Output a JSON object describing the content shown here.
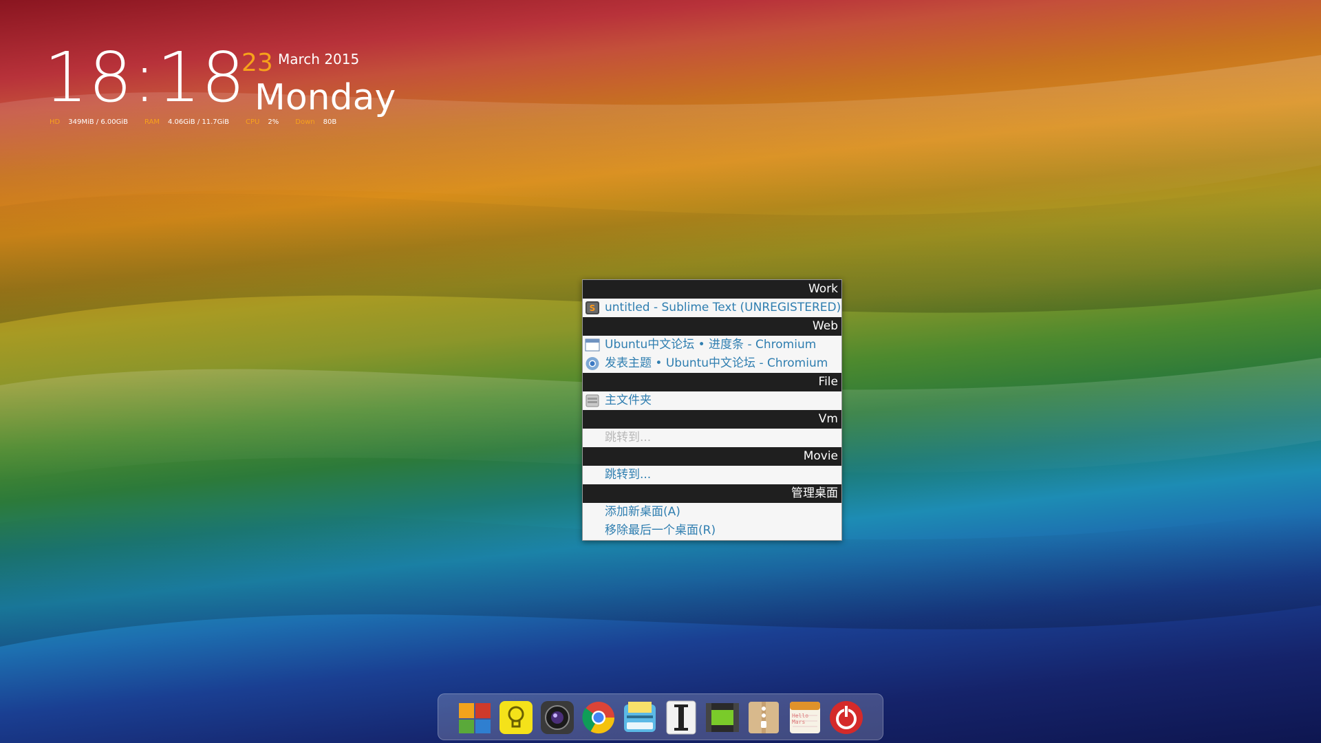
{
  "clock": {
    "time": "18:18",
    "day_number": "23",
    "month_year": "March 2015",
    "weekday": "Monday"
  },
  "stats": {
    "hd_label": "HD",
    "hd_value": "349MiB  / 6.00GiB",
    "ram_label": "RAM",
    "ram_value": "4.06GiB / 11.7GiB",
    "cpu_label": "CPU",
    "cpu_value": "2%",
    "down_label": "Down",
    "down_value": "80B"
  },
  "menu": {
    "sections": [
      {
        "header": "Work",
        "items": [
          {
            "label": "untitled - Sublime Text (UNREGISTERED)",
            "icon": "sublime-text-icon",
            "enabled": true
          }
        ]
      },
      {
        "header": "Web",
        "items": [
          {
            "label": "Ubuntu中文论坛 • 进度条 - Chromium",
            "icon": "browser-window-icon",
            "enabled": true
          },
          {
            "label": "发表主题 • Ubuntu中文论坛 - Chromium",
            "icon": "chromium-icon",
            "enabled": true
          }
        ]
      },
      {
        "header": "File",
        "items": [
          {
            "label": "主文件夹",
            "icon": "file-manager-icon",
            "enabled": true
          }
        ]
      },
      {
        "header": "Vm",
        "items": [
          {
            "label": "跳转到...",
            "icon": "",
            "enabled": false
          }
        ]
      },
      {
        "header": "Movie",
        "items": [
          {
            "label": "跳转到...",
            "icon": "",
            "enabled": true
          }
        ]
      },
      {
        "header": "管理桌面",
        "items": [
          {
            "label": "添加新桌面(A)",
            "icon": "",
            "enabled": true
          },
          {
            "label": "移除最后一个桌面(R)",
            "icon": "",
            "enabled": true
          }
        ]
      }
    ]
  },
  "dock": {
    "items": [
      {
        "icon": "app-launcher-icon"
      },
      {
        "icon": "lightbulb-icon"
      },
      {
        "icon": "camera-icon"
      },
      {
        "icon": "chrome-icon"
      },
      {
        "icon": "scanner-icon"
      },
      {
        "icon": "text-editor-icon"
      },
      {
        "icon": "battery-icon"
      },
      {
        "icon": "archive-icon"
      },
      {
        "icon": "notes-icon"
      },
      {
        "icon": "power-icon"
      }
    ],
    "notes_icon_text": "Hello Mars"
  },
  "colors": {
    "accent_orange": "#f7a21b",
    "menu_link": "#2f7eb0",
    "menu_header_bg": "#1f1f1f"
  }
}
